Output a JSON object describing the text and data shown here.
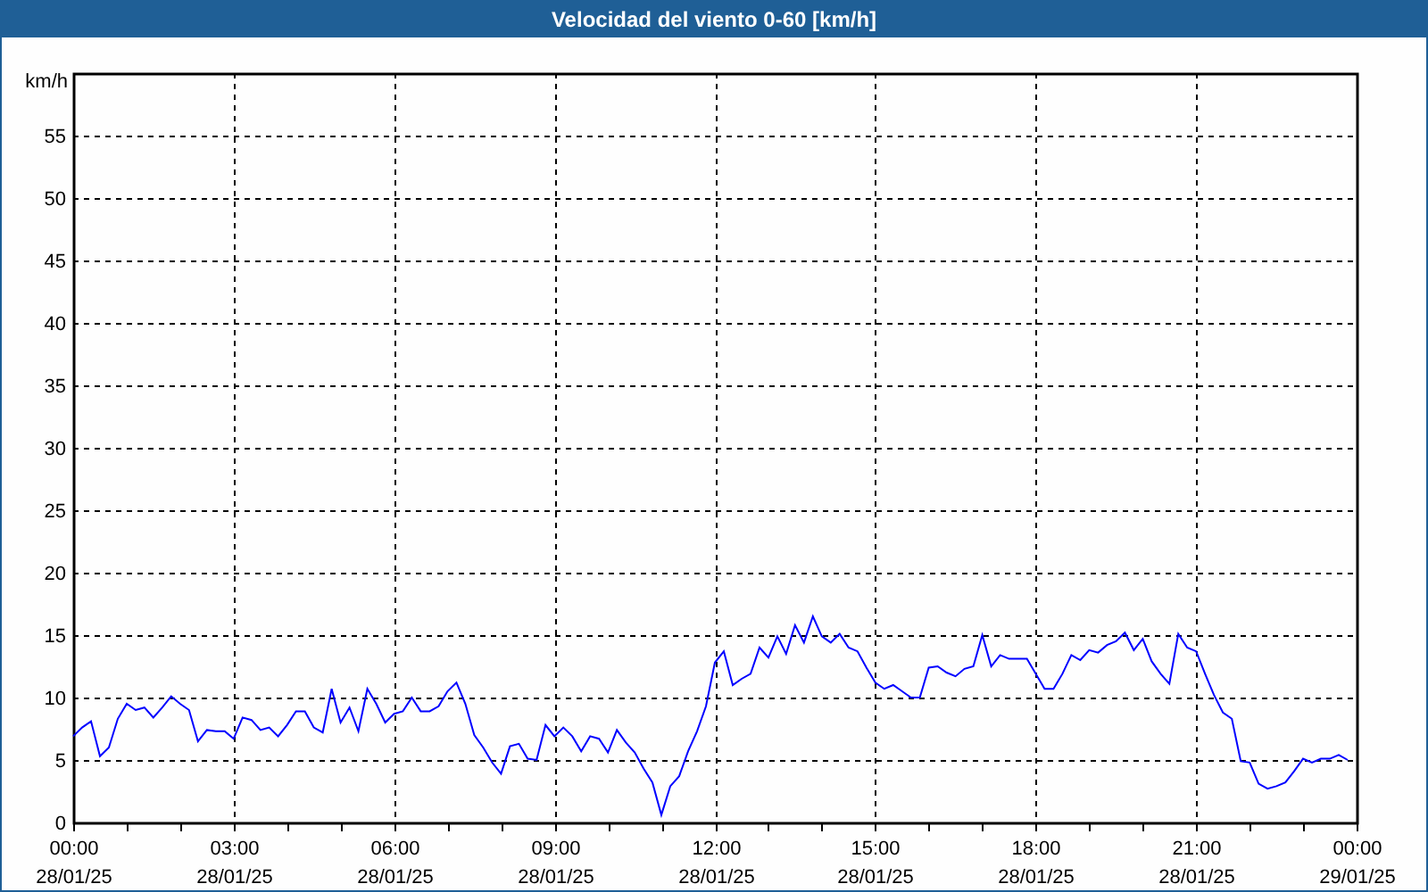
{
  "chart_data": {
    "type": "line",
    "grid": true,
    "title": "Velocidad del viento 0-60 [km/h]",
    "ylabel": "km/h",
    "ylim": [
      0,
      60
    ],
    "yticks": [
      0,
      5,
      10,
      15,
      20,
      25,
      30,
      35,
      40,
      45,
      50,
      55
    ],
    "categories": [
      "00:00\n28/01/25",
      null,
      null,
      null,
      null,
      null,
      null,
      null,
      null,
      null,
      null,
      null,
      null,
      null,
      null,
      null,
      null,
      null,
      "03:00\n28/01/25",
      null,
      null,
      null,
      null,
      null,
      null,
      null,
      null,
      null,
      null,
      null,
      null,
      null,
      null,
      null,
      null,
      null,
      "06:00\n28/01/25",
      null,
      null,
      null,
      null,
      null,
      null,
      null,
      null,
      null,
      null,
      null,
      null,
      null,
      null,
      null,
      null,
      null,
      "09:00\n28/01/25",
      null,
      null,
      null,
      null,
      null,
      null,
      null,
      null,
      null,
      null,
      null,
      null,
      null,
      null,
      null,
      null,
      null,
      "12:00\n28/01/25",
      null,
      null,
      null,
      null,
      null,
      null,
      null,
      null,
      null,
      null,
      null,
      null,
      null,
      null,
      null,
      null,
      null,
      "15:00\n28/01/25",
      null,
      null,
      null,
      null,
      null,
      null,
      null,
      null,
      null,
      null,
      null,
      null,
      null,
      null,
      null,
      null,
      null,
      "18:00\n28/01/25",
      null,
      null,
      null,
      null,
      null,
      null,
      null,
      null,
      null,
      null,
      null,
      null,
      null,
      null,
      null,
      null,
      null,
      "21:00\n28/01/25",
      null,
      null,
      null,
      null,
      null,
      null,
      null,
      null,
      null,
      null,
      null,
      null,
      null,
      null,
      null,
      null,
      null,
      "00:00\n29/01/25"
    ],
    "series": [
      {
        "color": "#0000ff",
        "values": [
          6.9,
          7.6,
          8.1,
          5.3,
          6.0,
          8.3,
          9.5,
          9.0,
          9.2,
          8.4,
          9.2,
          10.1,
          9.5,
          9.0,
          6.5,
          7.4,
          7.3,
          7.3,
          6.7,
          8.4,
          8.2,
          7.4,
          7.6,
          6.9,
          7.8,
          8.9,
          8.9,
          7.6,
          7.2,
          10.7,
          8.0,
          9.2,
          7.3,
          10.7,
          9.5,
          8.0,
          8.7,
          8.9,
          10.0,
          8.9,
          8.9,
          9.3,
          10.5,
          11.2,
          9.5,
          7.0,
          6.0,
          4.8,
          3.9,
          6.1,
          6.3,
          5.1,
          5.0,
          7.8,
          6.9,
          7.6,
          6.9,
          5.7,
          6.9,
          6.7,
          5.6,
          7.4,
          6.4,
          5.6,
          4.3,
          3.2,
          0.6,
          2.9,
          3.7,
          5.7,
          7.3,
          9.3,
          12.8,
          13.7,
          11.0,
          11.5,
          11.9,
          14.0,
          13.2,
          14.9,
          13.5,
          15.8,
          14.4,
          16.5,
          14.9,
          14.4,
          15.1,
          14.0,
          13.7,
          12.4,
          11.2,
          10.7,
          11.0,
          10.5,
          10.0,
          10.0,
          12.4,
          12.5,
          12.0,
          11.7,
          12.3,
          12.5,
          15.0,
          12.5,
          13.4,
          13.1,
          13.1,
          13.1,
          11.9,
          10.7,
          10.7,
          11.9,
          13.4,
          13.0,
          13.8,
          13.6,
          14.2,
          14.5,
          15.2,
          13.8,
          14.7,
          12.9,
          11.9,
          11.1,
          15.1,
          14.0,
          13.7,
          11.9,
          10.2,
          8.8,
          8.3,
          4.9,
          4.8,
          3.1,
          2.7,
          2.9,
          3.2,
          4.1,
          5.1,
          4.8,
          5.1,
          5.1,
          5.4,
          5.0,
          null
        ]
      }
    ]
  }
}
